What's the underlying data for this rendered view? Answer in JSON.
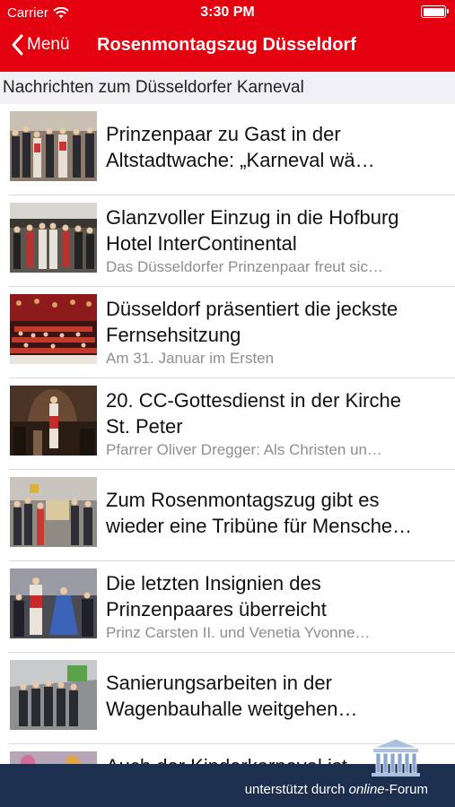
{
  "status_bar": {
    "carrier": "Carrier",
    "time": "3:30 PM"
  },
  "nav": {
    "back_label": "Menü",
    "title": "Rosenmontagszug Düsseldorf"
  },
  "section": {
    "title": "Nachrichten zum Düsseldorfer Karneval"
  },
  "articles": [
    {
      "line1": "Prinzenpaar zu Gast in der",
      "line2": "Altstadtwache: „Karneval wä…",
      "sub": ""
    },
    {
      "line1": "Glanzvoller Einzug in die Hofburg",
      "line2": "Hotel InterContinental",
      "sub": "Das Düsseldorfer Prinzenpaar freut sic…"
    },
    {
      "line1": "Düsseldorf präsentiert die jeckste",
      "line2": "Fernsehsitzung",
      "sub": "Am 31. Januar im Ersten"
    },
    {
      "line1": "20. CC-Gottesdienst in der Kirche",
      "line2": "St. Peter",
      "sub": "Pfarrer Oliver Dregger: Als Christen un…"
    },
    {
      "line1": "Zum Rosenmontagszug gibt es",
      "line2": "wieder eine Tribüne für Mensche…",
      "sub": ""
    },
    {
      "line1": "Die letzten Insignien des",
      "line2": "Prinzenpaares überreicht",
      "sub": "Prinz Carsten II. und Venetia Yvonne…"
    },
    {
      "line1": "Sanierungsarbeiten in der",
      "line2": "Wagenbauhalle weitgehen…",
      "sub": ""
    },
    {
      "line1": "Auch der Kinderkarneval ist",
      "line2": "",
      "sub": ""
    }
  ],
  "footer": {
    "prefix": "unterstützt durch ",
    "brand_italic": "online",
    "suffix": "-Forum"
  },
  "colors": {
    "nav_red": "#e3000f",
    "footer_navy": "#1d2f4e",
    "section_gray": "#efeff4"
  },
  "icons": {
    "back": "chevron-left-icon",
    "wifi": "wifi-icon",
    "battery": "battery-icon",
    "logo": "temple-logo-icon"
  }
}
